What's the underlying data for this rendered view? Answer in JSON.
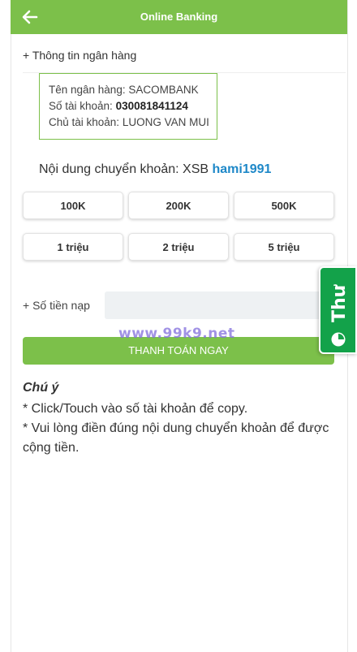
{
  "header": {
    "title": "Online Banking",
    "back_icon": "arrow-left-icon"
  },
  "section_label": "+ Thông tin ngân hàng",
  "bank": {
    "name_label": "Tên ngân hàng: ",
    "name_value": "SACOMBANK",
    "account_label": "Số tài khoản: ",
    "account_value": "030081841124",
    "holder_label": "Chủ tài khoản: ",
    "holder_value": "LUONG VAN MUI"
  },
  "transfer": {
    "label": "Nội dung chuyển khoản: XSB ",
    "code": "hami1991"
  },
  "amounts": [
    "100K",
    "200K",
    "500K",
    "1 triệu",
    "2 triệu",
    "5 triệu"
  ],
  "amount_field": {
    "label": "+ Số tiền nạp",
    "value": "",
    "placeholder": ""
  },
  "pay_button": "THANH TOÁN NGAY",
  "watermark": "www.99k9.net",
  "side_tab": {
    "label": "Thư",
    "icon": "chat-bubble-icon"
  },
  "notes": {
    "title": "Chú ý",
    "lines": [
      "* Click/Touch vào số tài khoản để copy.",
      "* Vui lòng điền đúng nội dung chuyển khoản để được cộng tiền."
    ]
  },
  "colors": {
    "accent": "#7cc04a",
    "link": "#1e88c8",
    "side_tab": "#13a24a"
  }
}
